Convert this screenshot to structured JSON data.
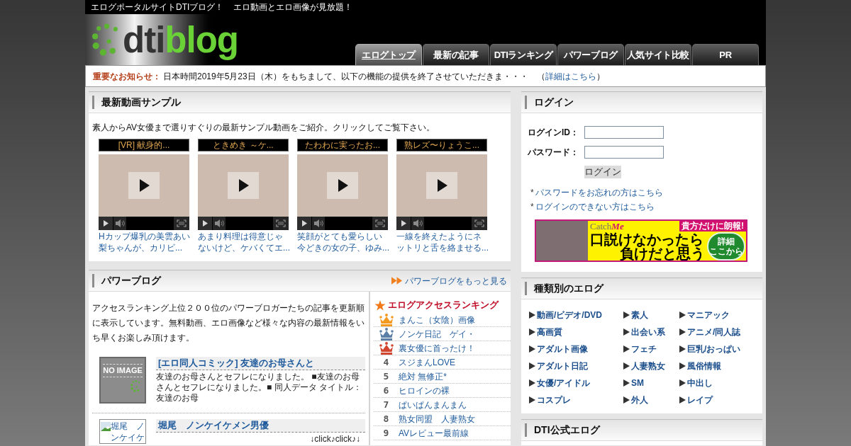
{
  "topbar": {
    "texts": [
      "エログポータルサイトDTIブログ！",
      "エロ動画とエロ画像が見放題！"
    ]
  },
  "logo": {
    "parts": [
      "dti",
      "blog"
    ]
  },
  "nav": [
    {
      "label": "エログトップ",
      "selected": true
    },
    {
      "label": "最新の記事",
      "selected": false
    },
    {
      "label": "DTIランキング",
      "selected": false
    },
    {
      "label": "パワーブログ",
      "selected": false
    },
    {
      "label": "人気サイト比較",
      "selected": false
    },
    {
      "label": "PR",
      "selected": false
    }
  ],
  "notice": {
    "label": "重要なお知らせ：",
    "text": "日本時間2019年5月23日（木）をもちまして、以下の機能の提供を終了させていただきま・・・　（",
    "link": "詳細はこちら",
    "text_after": "）"
  },
  "video_section": {
    "title": "最新動画サンプル",
    "intro": "素人からAV女優まで選りすぐりの最新サンプル動画をご紹介。クリックしてご覧下さい。",
    "videos": [
      {
        "title": "[VR] 献身的...",
        "description": "Hカップ爆乳の美雲あい梨ちゃんが、カリビ..."
      },
      {
        "title": "ときめき ～ケ...",
        "description": "あまり料理は得意じゃないけど、ケバくてエ..."
      },
      {
        "title": "たわわに実ったお...",
        "description": "笑顔がとても愛らしい今どきの女の子、ゆみ..."
      },
      {
        "title": "熟レズ〜りょうこ...",
        "description": "一線を終えたようにネットリと舌を絡ませる..."
      }
    ]
  },
  "power_blog": {
    "title": "パワーブログ",
    "more_link": "パワーブログをもっと見る",
    "intro": "アクセスランキング上位２００位のパワーブロガーたちの記事を更新順に表示しています。無料動画、エロ画像など様々な内容の最新情報をいち早くお楽しみ頂けます。",
    "entries": [
      {
        "kind": "no_image",
        "thumb_text": "NO IMAGE",
        "title": "[エロ同人コミック] 友達のお母さんと",
        "excerpt": "友達のお母さんとセフレになりました。 ■友達のお母さんとセフレになりました。■ 同人データ タイトル：友達のお母"
      },
      {
        "kind": "broken_image",
        "thumb_text": "堀尾　ノンケイケ",
        "title": "堀尾　ノンケイケメン男優",
        "excerpt": "↓click♪click♪↓"
      }
    ],
    "ranking": {
      "title": "エログアクセスランキング",
      "items": [
        {
          "kind": "crown",
          "color": "#f39a1e",
          "title": "まんこ（女陰）画像"
        },
        {
          "kind": "crown",
          "color": "#5b7fa6",
          "title": "ノンケ日記　ゲイ・"
        },
        {
          "kind": "crown",
          "color": "#d2452f",
          "title": "裏女優に首ったけ！"
        },
        {
          "kind": "number",
          "rank": "4",
          "title": "スジまんLOVE"
        },
        {
          "kind": "number",
          "rank": "5",
          "title": "絶対 無修正*"
        },
        {
          "kind": "number",
          "rank": "6",
          "title": "ヒロインの裸"
        },
        {
          "kind": "number",
          "rank": "7",
          "title": "ぱいぱんまんまん"
        },
        {
          "kind": "number",
          "rank": "8",
          "title": "熟女同盟　人妻熟女"
        },
        {
          "kind": "number",
          "rank": "9",
          "title": "AVレビュー最前線"
        }
      ]
    }
  },
  "login": {
    "title": "ログイン",
    "fields": [
      {
        "label": "ログインID："
      },
      {
        "label": "パスワード："
      }
    ],
    "button": "ログイン",
    "links": [
      {
        "marker": "*",
        "text": "パスワードをお忘れの方はこちら"
      },
      {
        "marker": "*",
        "text": "ログインのできない方はこちら"
      }
    ],
    "banner": {
      "brand_parts": [
        "Catch",
        "Me"
      ],
      "tag": "貴方だけに朗報!",
      "headline": [
        "口説けなかったら",
        "負けだと思う"
      ],
      "badge": [
        "詳細",
        "ここから"
      ]
    }
  },
  "categories": {
    "title": "種類別のエログ",
    "items": [
      "動画/ビデオ/DVD",
      "素人",
      "マニアック",
      "高画質",
      "出会い系",
      "アニメ/同人誌",
      "アダルト画像",
      "フェチ",
      "巨乳/おっぱい",
      "アダルト日記",
      "人妻熟女",
      "風俗情報",
      "女優/アイドル",
      "SM",
      "中出し",
      "コスプレ",
      "外人",
      "レイプ"
    ]
  },
  "official": {
    "title": "DTI公式エログ"
  }
}
